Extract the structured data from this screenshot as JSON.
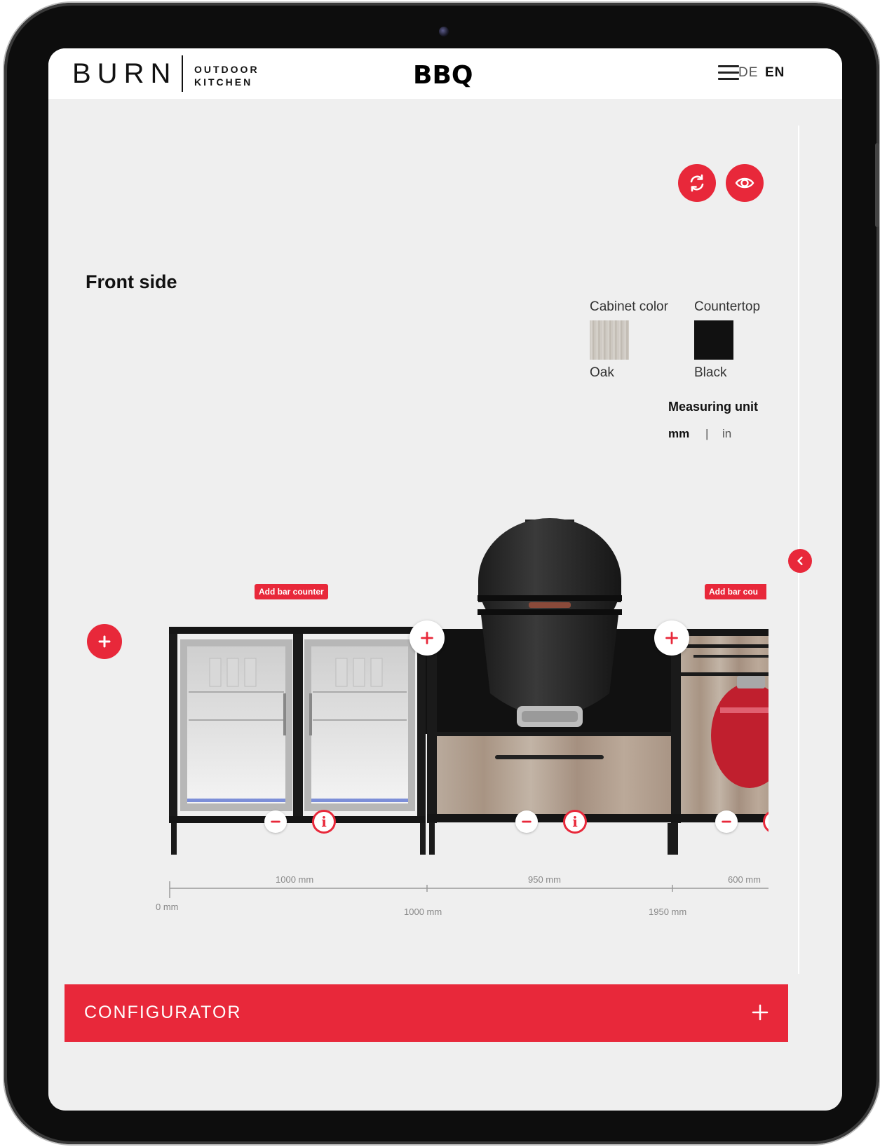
{
  "header": {
    "logo_main": "BURN",
    "logo_sub_line1": "OUTDOOR",
    "logo_sub_line2": "KITCHEN",
    "page_label": "BBQ",
    "lang_de": "DE",
    "lang_en": "EN"
  },
  "view": {
    "title": "Front side"
  },
  "options": {
    "cabinet_color_label": "Cabinet color",
    "cabinet_color_value": "Oak",
    "countertop_label": "Countertop",
    "countertop_value": "Black",
    "measuring_unit_label": "Measuring unit",
    "unit_mm": "mm",
    "unit_separator": "|",
    "unit_in": "in"
  },
  "kitchen": {
    "bar_counter_left": "Add bar counter",
    "bar_counter_right": "Add bar cou",
    "modules": [
      {
        "type": "double fridge",
        "width_label": "1000 mm"
      },
      {
        "type": "grill module",
        "width_label": "950 mm"
      },
      {
        "type": "gas cabinet",
        "width_label": "600 mm"
      }
    ],
    "ruler": {
      "start": "0 mm",
      "mark1": "1000 mm",
      "mark2": "1950 mm"
    },
    "info_glyph": "i"
  },
  "footer": {
    "configurator_label": "CONFIGURATOR"
  },
  "colors": {
    "accent": "#e8283a",
    "background": "#efefef",
    "header": "#ffffff"
  }
}
